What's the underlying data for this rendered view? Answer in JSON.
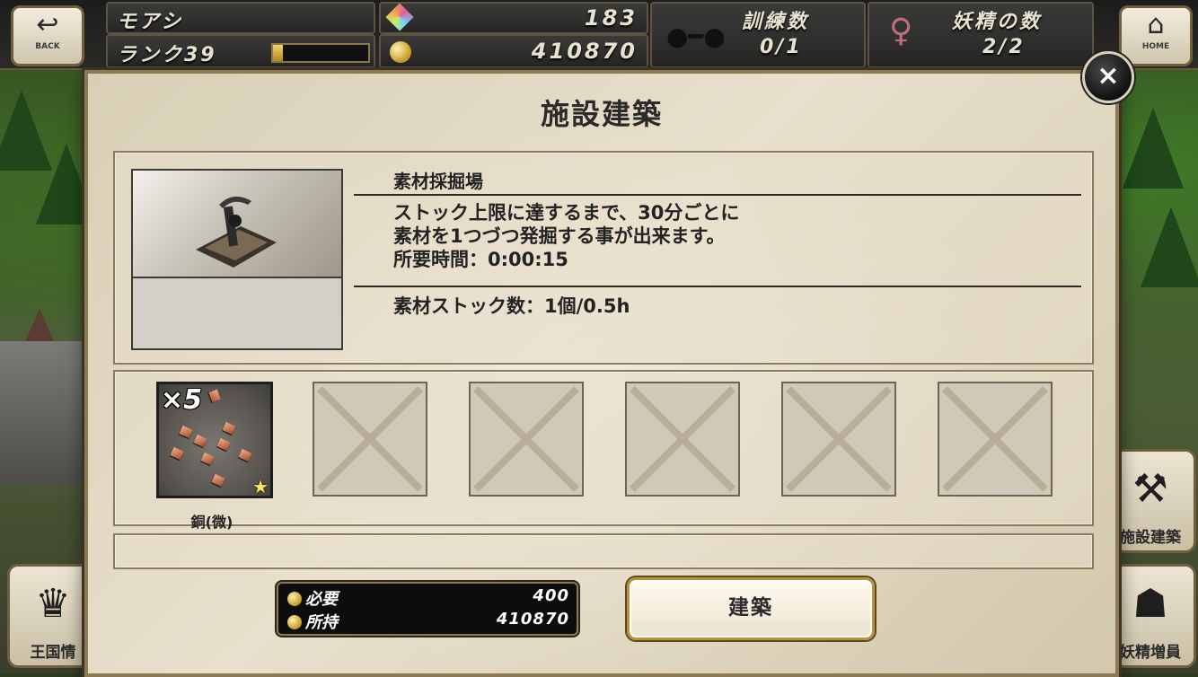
{
  "hud": {
    "player_name": "モアシ",
    "rank_label": "ランク39",
    "gems": "183",
    "gold": "410870",
    "training_label": "訓練数",
    "training_value": "0/1",
    "fairy_label": "妖精の数",
    "fairy_value": "2/2",
    "back_label": "BACK",
    "home_label": "HOME",
    "rank_progress": 0.1
  },
  "side_buttons": {
    "kingdom_info": "王国情",
    "facility_build": "施設建築",
    "fairy_increase": "妖精増員"
  },
  "dialog": {
    "title": "施設建築",
    "facility_name": "素材採掘場",
    "desc_line1": "ストック上限に達するまで、30分ごとに",
    "desc_line2": "素材を1つづつ発掘する事が出来ます。",
    "required_time": "所要時間：0:00:15",
    "stock": "素材ストック数：1個/0.5h",
    "close_label": "×",
    "item": {
      "qty": "×5",
      "name": "銅(微)"
    },
    "cost": {
      "required_label": "必要",
      "required_value": "400",
      "owned_label": "所持",
      "owned_value": "410870"
    },
    "build_label": "建築"
  },
  "colors": {
    "accent_gold": "#b8913b",
    "panel_border": "#8a7b5c"
  }
}
